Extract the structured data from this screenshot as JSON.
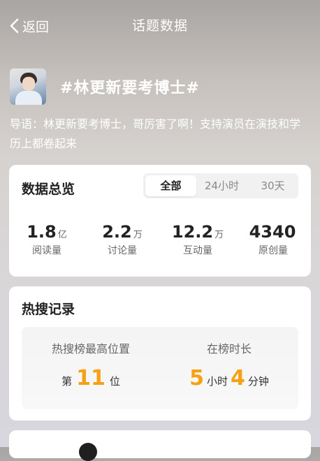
{
  "nav": {
    "back_label": "返回",
    "title": "话题数据"
  },
  "topic": {
    "title": "#林更新要考博士#",
    "intro": "导语：林更新要考博士，哥厉害了啊！支持演员在演技和学历上都卷起来"
  },
  "overview": {
    "title": "数据总览",
    "tabs": [
      {
        "label": "全部",
        "active": true
      },
      {
        "label": "24小时",
        "active": false
      },
      {
        "label": "30天",
        "active": false
      }
    ],
    "stats": [
      {
        "value": "1.8",
        "unit": "亿",
        "label": "阅读量"
      },
      {
        "value": "2.2",
        "unit": "万",
        "label": "讨论量"
      },
      {
        "value": "12.2",
        "unit": "万",
        "label": "互动量"
      },
      {
        "value": "4340",
        "unit": "",
        "label": "原创量"
      }
    ]
  },
  "hot_search": {
    "title": "热搜记录",
    "peak_label": "热搜榜最高位置",
    "peak_prefix": "第",
    "peak_value": "11",
    "peak_suffix": "位",
    "duration_label": "在榜时长",
    "duration_hours": "5",
    "hours_unit": "小时",
    "duration_minutes": "4",
    "minutes_unit": "分钟"
  },
  "colors": {
    "accent": "#f5a015",
    "card": "#ffffff",
    "text": "#222222"
  }
}
